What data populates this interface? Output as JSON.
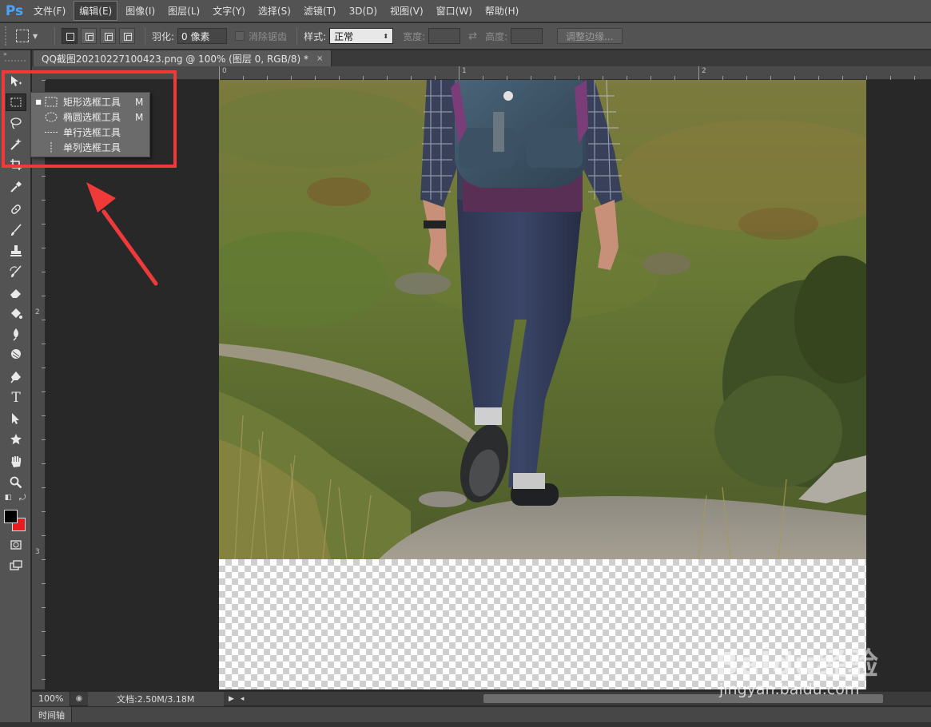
{
  "app": {
    "logo": "Ps",
    "accent": "#31a8ff"
  },
  "menu": [
    {
      "label": "文件(F)"
    },
    {
      "label": "编辑(E)"
    },
    {
      "label": "图像(I)"
    },
    {
      "label": "图层(L)"
    },
    {
      "label": "文字(Y)"
    },
    {
      "label": "选择(S)"
    },
    {
      "label": "滤镜(T)"
    },
    {
      "label": "3D(D)"
    },
    {
      "label": "视图(V)"
    },
    {
      "label": "窗口(W)"
    },
    {
      "label": "帮助(H)"
    }
  ],
  "active_menu": "编辑(E)",
  "options": {
    "feather_label": "羽化:",
    "feather_value": "0 像素",
    "antialias_label": "消除锯齿",
    "style_label": "样式:",
    "style_value": "正常",
    "width_label": "宽度:",
    "height_label": "高度:",
    "refine_edge_label": "调整边缘..."
  },
  "document": {
    "tab_title": "QQ截图20210227100423.png @ 100% (图层 0, RGB/8) *",
    "close_glyph": "×"
  },
  "rulers": {
    "top": [
      "0",
      "1",
      "2"
    ],
    "left": [
      "2",
      "3"
    ]
  },
  "flyout": {
    "items": [
      {
        "label": "矩形选框工具",
        "shortcut": "M",
        "icon": "rect-marquee-icon",
        "active": true
      },
      {
        "label": "椭圆选框工具",
        "shortcut": "M",
        "icon": "ellipse-marquee-icon",
        "active": false
      },
      {
        "label": "单行选框工具",
        "shortcut": "",
        "icon": "single-row-marquee-icon",
        "active": false
      },
      {
        "label": "单列选框工具",
        "shortcut": "",
        "icon": "single-column-marquee-icon",
        "active": false
      }
    ]
  },
  "tools": [
    "move-tool",
    "marquee-tool",
    "lasso-tool",
    "magic-wand-tool",
    "crop-tool",
    "eyedropper-tool",
    "healing-brush-tool",
    "brush-tool",
    "clone-stamp-tool",
    "history-brush-tool",
    "eraser-tool",
    "paint-bucket-tool",
    "blur-tool",
    "dodge-tool",
    "pen-tool",
    "type-tool",
    "path-selection-tool",
    "shape-tool",
    "hand-tool",
    "zoom-tool"
  ],
  "colors": {
    "foreground": "#000000",
    "background": "#e81c1c",
    "annotation": "#f03a3a"
  },
  "status": {
    "zoom": "100%",
    "doc_info": "文档:2.50M/3.18M"
  },
  "timeline": {
    "label": "时间轴"
  },
  "watermark": {
    "logo": "Baidu经验",
    "url": "jingyan.baidu.com"
  }
}
